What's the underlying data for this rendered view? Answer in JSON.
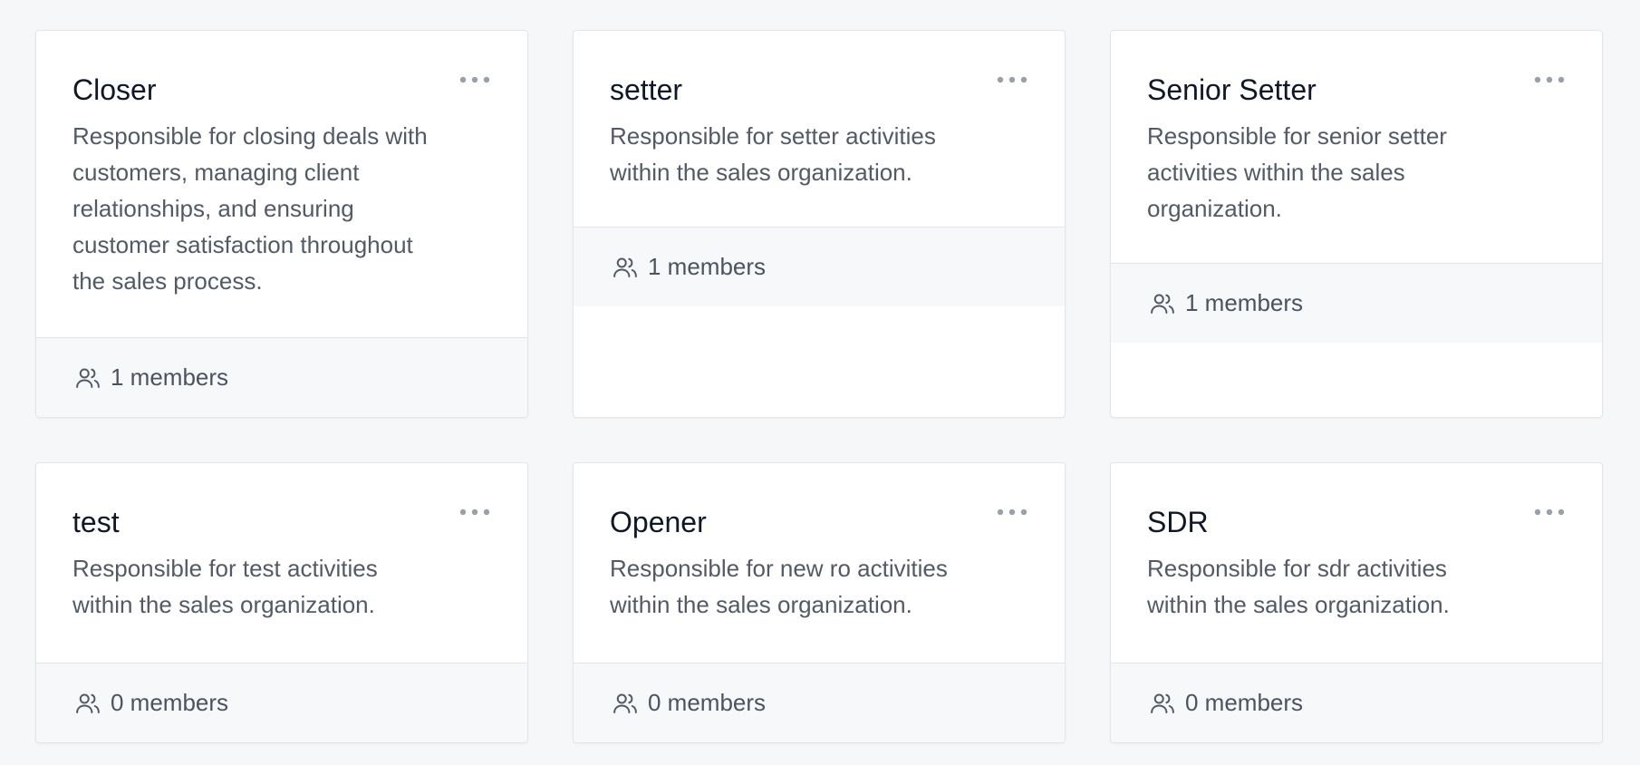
{
  "cards": [
    {
      "title": "Closer",
      "description": "Responsible for closing deals with customers, managing client relationships, and ensuring customer satisfaction throughout the sales process.",
      "members": "1 members"
    },
    {
      "title": "setter",
      "description": "Responsible for setter activities within the sales organization.",
      "members": "1 members"
    },
    {
      "title": "Senior Setter",
      "description": "Responsible for senior setter activities within the sales organization.",
      "members": "1 members"
    },
    {
      "title": "test",
      "description": "Responsible for test activities within the sales organization.",
      "members": "0 members"
    },
    {
      "title": "Opener",
      "description": "Responsible for new ro activities within the sales organization.",
      "members": "0 members"
    },
    {
      "title": "SDR",
      "description": "Responsible for sdr activities within the sales organization.",
      "members": "0 members"
    }
  ],
  "icons": {
    "more": "more-horizontal-icon",
    "members": "users-icon"
  },
  "colors": {
    "background": "#f6f7f9",
    "card": "#ffffff",
    "footer": "#f7f8fa",
    "border": "#e3e5e9",
    "title": "#101828",
    "text": "#535a66",
    "icon": "#9aa0aa"
  }
}
